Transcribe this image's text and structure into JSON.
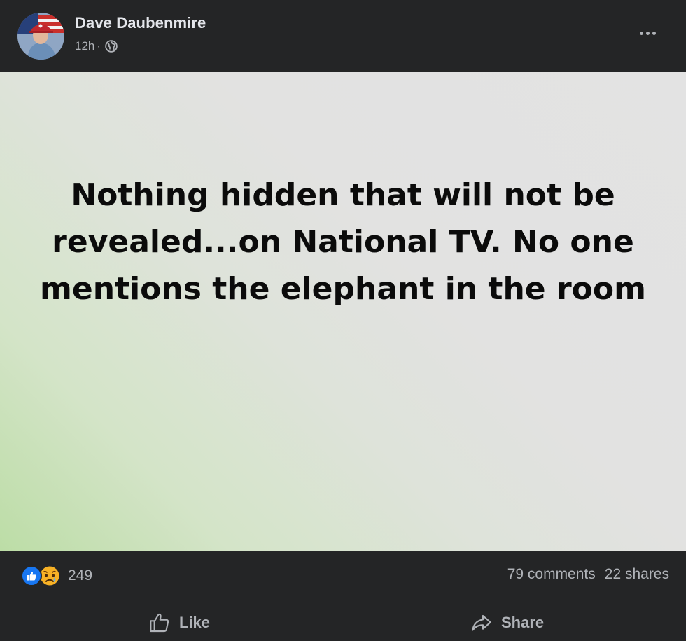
{
  "post": {
    "author": "Dave Daubenmire",
    "time": "12h",
    "separator": "·",
    "privacy_icon": "globe-icon",
    "text": "Nothing hidden that will not be revealed...on National TV. No one mentions the elephant in the room",
    "background_colors": [
      "#bcdda6",
      "#e3e3e3"
    ]
  },
  "stats": {
    "reaction_count": "249",
    "reaction_icons": [
      "like-icon",
      "sad-icon"
    ],
    "comments": "79 comments",
    "shares": "22 shares"
  },
  "actions": {
    "like_label": "Like",
    "share_label": "Share"
  },
  "colors": {
    "background": "#242526",
    "primary_text": "#e4e6eb",
    "secondary_text": "#b0b3b8",
    "like_blue": "#1877f2"
  }
}
